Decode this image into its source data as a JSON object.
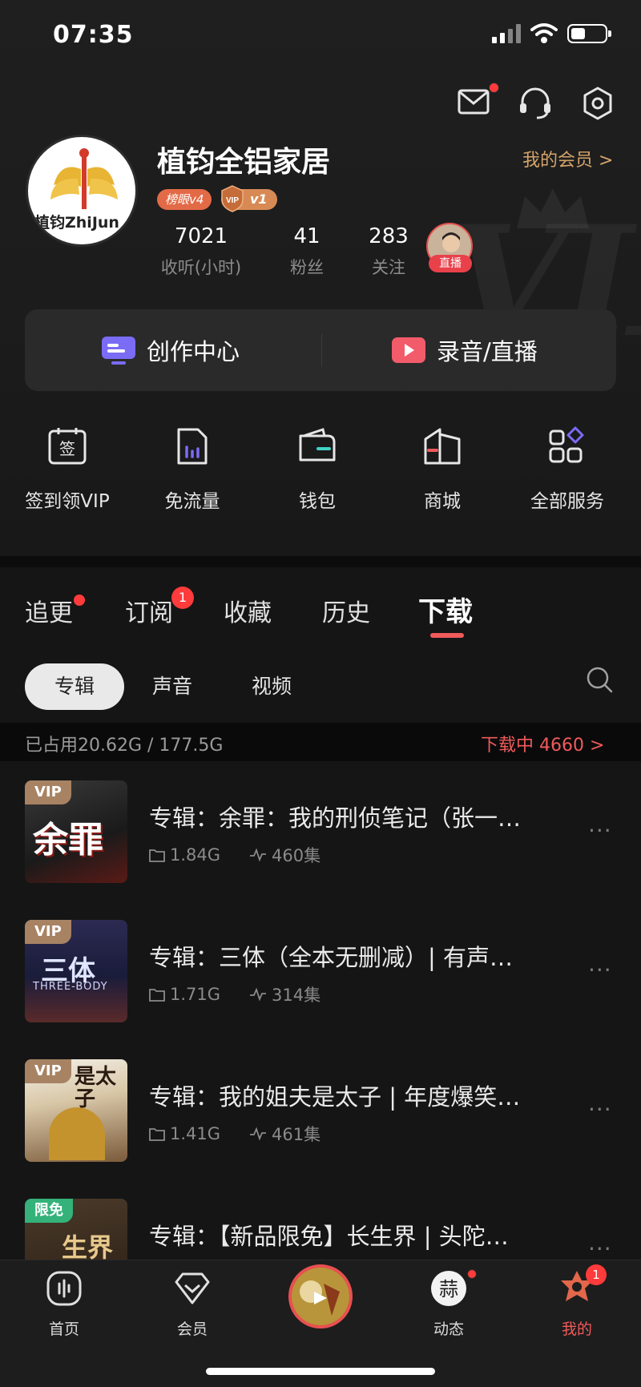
{
  "status_bar": {
    "time": "07:35"
  },
  "profile": {
    "avatar_text": "植钧ZhiJun",
    "name": "植钧全铝家居",
    "my_member_label": "我的会员 >",
    "rank_badge": "榜眼v4",
    "vip_badge_shield": "VIP",
    "vip_badge_level": "v1",
    "stats": [
      {
        "value": "7021",
        "label": "收听(小时)"
      },
      {
        "value": "41",
        "label": "粉丝"
      },
      {
        "value": "283",
        "label": "关注"
      }
    ],
    "live_tag": "直播"
  },
  "create_actions": [
    {
      "label": "创作中心",
      "icon": "creator-center-icon"
    },
    {
      "label": "录音/直播",
      "icon": "record-live-icon"
    }
  ],
  "services": [
    {
      "label": "签到领VIP",
      "icon": "checkin-icon",
      "glyph": "签"
    },
    {
      "label": "免流量",
      "icon": "free-data-icon"
    },
    {
      "label": "钱包",
      "icon": "wallet-icon"
    },
    {
      "label": "商城",
      "icon": "mall-icon"
    },
    {
      "label": "全部服务",
      "icon": "all-services-icon"
    }
  ],
  "tabs": [
    {
      "label": "追更"
    },
    {
      "label": "订阅",
      "badge": "1"
    },
    {
      "label": "收藏"
    },
    {
      "label": "历史"
    },
    {
      "label": "下载",
      "active": true
    }
  ],
  "chips": [
    {
      "label": "专辑",
      "active": true
    },
    {
      "label": "声音"
    },
    {
      "label": "视频"
    }
  ],
  "storage": {
    "used": "已占用20.62G / 177.5G",
    "downloading": "下载中 4660 >"
  },
  "albums": [
    {
      "title": "专辑：余罪：我的刑侦笔记（张一…",
      "size": "1.84G",
      "episodes": "460集",
      "tag": "VIP",
      "cover_text": "余罪"
    },
    {
      "title": "专辑：三体（全本无删减）| 有声…",
      "size": "1.71G",
      "episodes": "314集",
      "tag": "VIP",
      "cover_text": "三体",
      "cover_subtext": "THREE-BODY"
    },
    {
      "title": "专辑：我的姐夫是太子 | 年度爆笑…",
      "size": "1.41G",
      "episodes": "461集",
      "tag": "VIP",
      "cover_text": "是太子"
    },
    {
      "title": "专辑：【新品限免】长生界 | 头陀…",
      "tag": "限免",
      "cover_text": "生界"
    }
  ],
  "more_label": "···",
  "bottom_nav": [
    {
      "label": "首页",
      "icon": "home-icon"
    },
    {
      "label": "会员",
      "icon": "member-icon"
    },
    {
      "label": "",
      "icon": "now-playing-icon"
    },
    {
      "label": "动态",
      "icon": "feed-icon",
      "glyph": "蒜"
    },
    {
      "label": "我的",
      "icon": "mine-icon",
      "badge": "1",
      "active": true
    }
  ],
  "colors": {
    "accent_red": "#f05a5a",
    "gold": "#d6a46a",
    "background": "#151515"
  }
}
